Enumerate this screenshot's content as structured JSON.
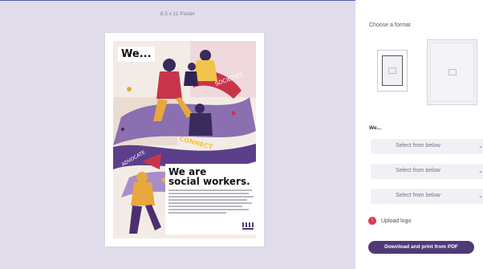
{
  "canvas": {
    "caption": "8.5 x 11 Poster"
  },
  "poster": {
    "we_text": "We...",
    "headline_line1": "We are",
    "headline_line2": "social workers.",
    "art_words": [
      "SOCIETIES",
      "CONNECT",
      "ADVOCATE"
    ]
  },
  "panel": {
    "choose_format": "Choose a format",
    "formats": [
      "format-small-poster",
      "format-large-poster"
    ],
    "section_label": "We...",
    "dropdowns": [
      "Select from below",
      "Select from below",
      "Select from below"
    ],
    "upload_label": "Upload logo",
    "download_button": "Download and print from PDF"
  },
  "colors": {
    "accent": "#4f3a78",
    "red": "#e0364a",
    "panel_bg": "#ffffff",
    "canvas_bg": "#e0dcea"
  }
}
